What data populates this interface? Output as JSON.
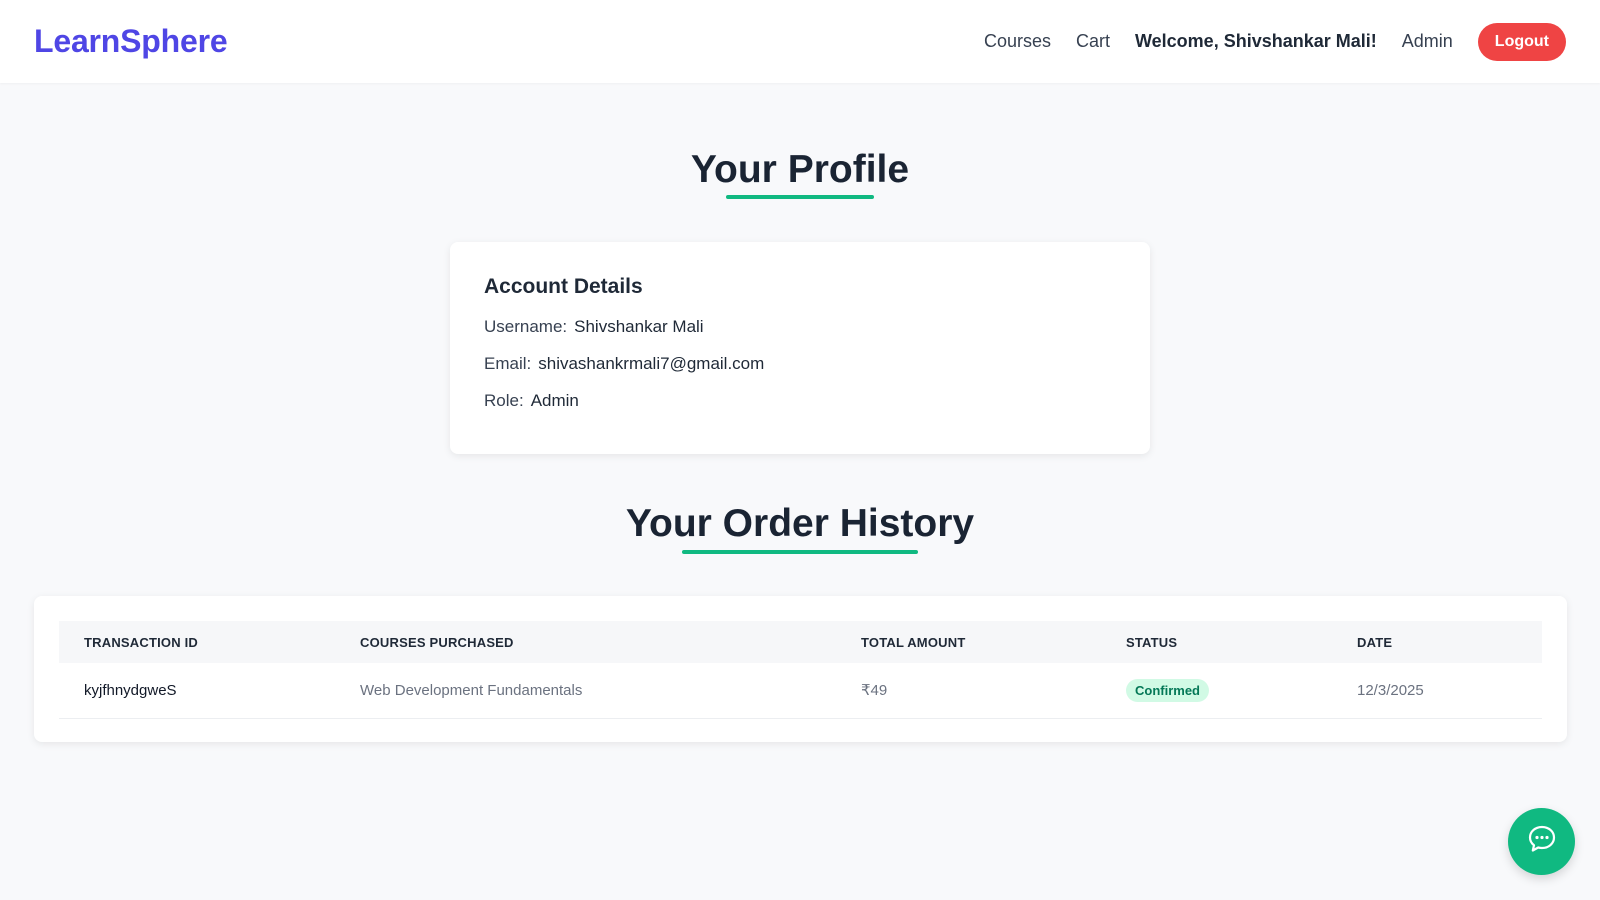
{
  "header": {
    "brand": "LearnSphere",
    "nav": {
      "courses": "Courses",
      "cart": "Cart",
      "welcome": "Welcome, Shivshankar Mali!",
      "admin": "Admin",
      "logout": "Logout"
    }
  },
  "profile": {
    "title": "Your Profile",
    "card_heading": "Account Details",
    "username_label": "Username:",
    "username": "Shivshankar Mali",
    "email_label": "Email:",
    "email": "shivashankrmali7@gmail.com",
    "role_label": "Role:",
    "role": "Admin"
  },
  "orders": {
    "title": "Your Order History",
    "columns": [
      "TRANSACTION ID",
      "COURSES PURCHASED",
      "TOTAL AMOUNT",
      "STATUS",
      "DATE"
    ],
    "rows": [
      {
        "transaction_id": "kyjfhnydgweS",
        "courses": "Web Development Fundamentals",
        "amount": "₹49",
        "status": "Confirmed",
        "date": "12/3/2025"
      }
    ]
  },
  "colors": {
    "brand": "#4f46e5",
    "accent": "#10b981",
    "logout": "#ef4444",
    "status_confirmed_bg": "#d1fae5",
    "status_confirmed_text": "#047857"
  },
  "icons": {
    "chat": "chat-bubble-icon"
  }
}
